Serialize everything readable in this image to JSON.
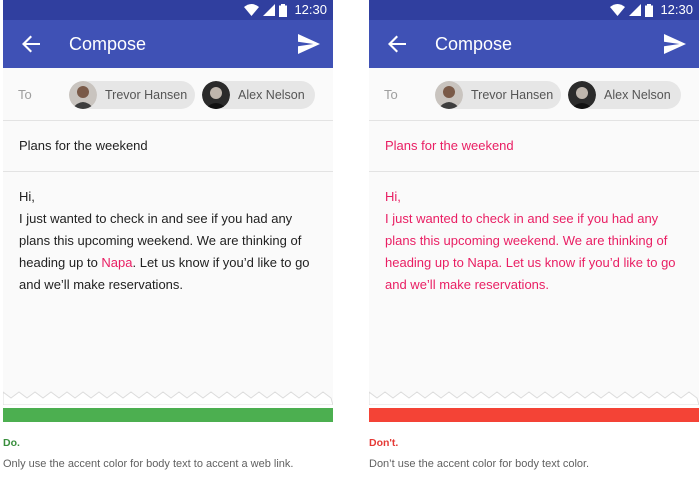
{
  "colors": {
    "status_bar": "#303f9f",
    "app_bar": "#3f51b5",
    "accent": "#e91e63",
    "do": "#4caf50",
    "dont": "#f44336"
  },
  "status_bar": {
    "time": "12:30",
    "icons": [
      "wifi-icon",
      "signal-icon",
      "battery-icon"
    ]
  },
  "app_bar": {
    "title": "Compose",
    "back_icon": "arrow-back-icon",
    "send_icon": "send-icon"
  },
  "to_field": {
    "label": "To",
    "recipients": [
      {
        "name": "Trevor Hansen",
        "avatar": "avatar-photo"
      },
      {
        "name": "Alex Nelson",
        "avatar": "avatar-photo"
      }
    ]
  },
  "email": {
    "subject": "Plans for the weekend",
    "greeting": "Hi,",
    "body_before_link": "I just wanted to check in and see if you had any plans this upcoming weekend. We are thinking of heading up to ",
    "link_text": "Napa",
    "body_after_link": ". Let us know if you’d like to go and we’ll make reservations."
  },
  "examples": {
    "do": {
      "label": "Do.",
      "caption": "Only use the accent color for body text to accent a web link."
    },
    "dont": {
      "label": "Don't.",
      "caption": "Don’t use the accent color for body text color."
    }
  }
}
